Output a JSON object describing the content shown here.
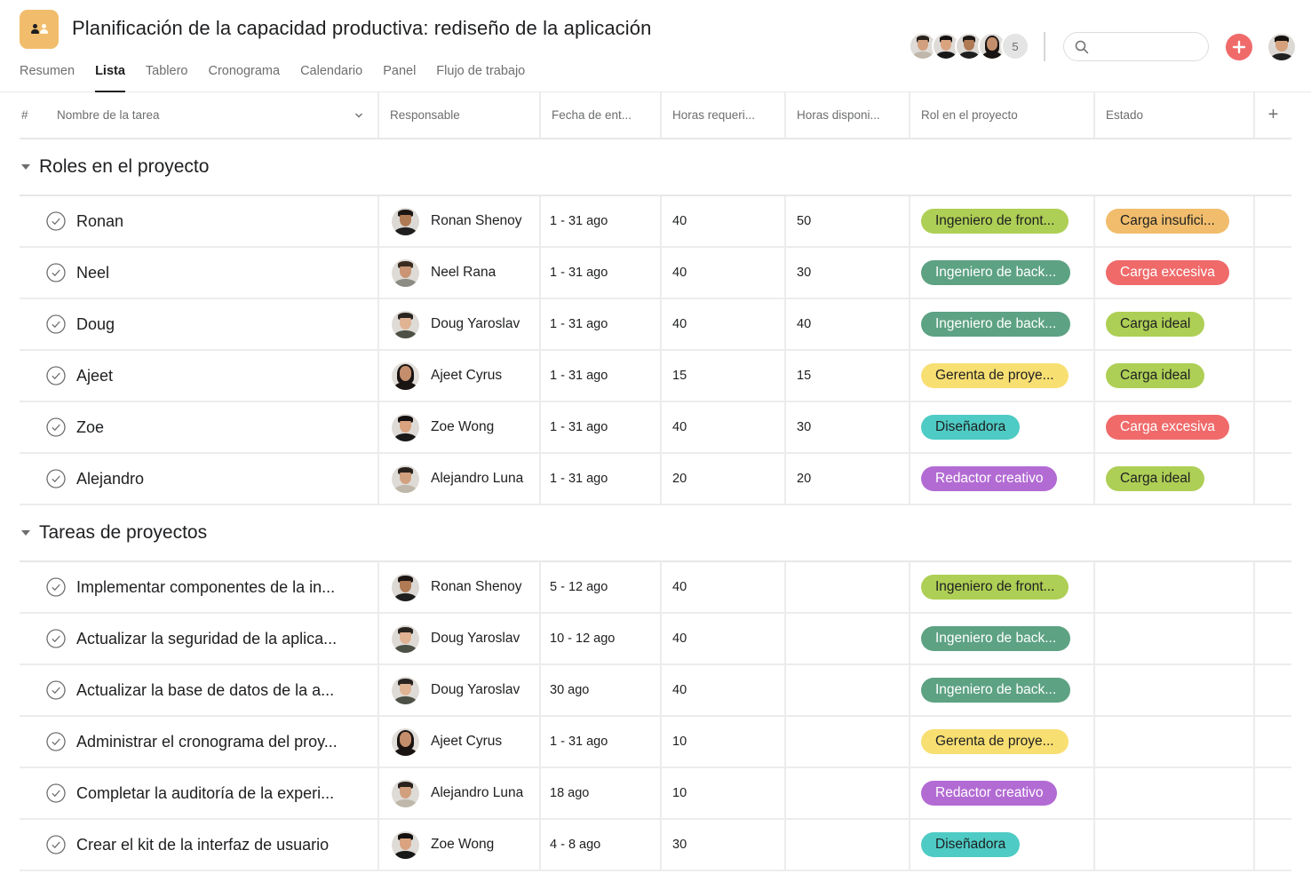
{
  "header": {
    "title": "Planificación de la capacidad productiva: rediseño de la aplicación",
    "project_icon": "people-icon",
    "project_icon_color": "#f1bd6c",
    "tabs": [
      {
        "label": "Resumen",
        "active": false
      },
      {
        "label": "Lista",
        "active": true
      },
      {
        "label": "Tablero",
        "active": false
      },
      {
        "label": "Cronograma",
        "active": false
      },
      {
        "label": "Calendario",
        "active": false
      },
      {
        "label": "Panel",
        "active": false
      },
      {
        "label": "Flujo de trabajo",
        "active": false
      }
    ],
    "members_count": "5",
    "search": {
      "placeholder": "",
      "value": ""
    },
    "add_button_color": "#f06a6a"
  },
  "columns": {
    "num": "#",
    "name": "Nombre de la tarea",
    "responsible": "Responsable",
    "due": "Fecha de ent...",
    "hours_required": "Horas requeri...",
    "hours_available": "Horas disponi...",
    "role": "Rol en el proyecto",
    "state": "Estado",
    "add": "+"
  },
  "colors": {
    "frontend": {
      "bg": "#aecf55",
      "fg": "#1e1f21"
    },
    "backend": {
      "bg": "#5da283",
      "fg": "#ffffff"
    },
    "pm": {
      "bg": "#f8df72",
      "fg": "#1e1f21"
    },
    "designer": {
      "bg": "#4ecbc4",
      "fg": "#1e1f21"
    },
    "writer": {
      "bg": "#b36bd4",
      "fg": "#ffffff"
    },
    "under": {
      "bg": "#f1bd6c",
      "fg": "#1e1f21"
    },
    "over": {
      "bg": "#f06a6a",
      "fg": "#ffffff"
    },
    "ideal": {
      "bg": "#aecf55",
      "fg": "#1e1f21"
    }
  },
  "sections": [
    {
      "title": "Roles en el proyecto",
      "rows": [
        {
          "name": "Ronan",
          "assignee": "Ronan Shenoy",
          "avatar": "ronan",
          "due": "1 - 31 ago",
          "req": "40",
          "avail": "50",
          "role": "Ingeniero de front...",
          "role_key": "frontend",
          "state": "Carga insufici...",
          "state_key": "under"
        },
        {
          "name": "Neel",
          "assignee": "Neel Rana",
          "avatar": "neel",
          "due": "1 - 31 ago",
          "req": "40",
          "avail": "30",
          "role": "Ingeniero de back...",
          "role_key": "backend",
          "state": "Carga excesiva",
          "state_key": "over"
        },
        {
          "name": "Doug",
          "assignee": "Doug Yaroslav",
          "avatar": "doug",
          "due": "1 - 31 ago",
          "req": "40",
          "avail": "40",
          "role": "Ingeniero de back...",
          "role_key": "backend",
          "state": "Carga ideal",
          "state_key": "ideal"
        },
        {
          "name": "Ajeet",
          "assignee": "Ajeet Cyrus",
          "avatar": "ajeet",
          "due": "1 - 31 ago",
          "req": "15",
          "avail": "15",
          "role": "Gerenta de proye...",
          "role_key": "pm",
          "state": "Carga ideal",
          "state_key": "ideal"
        },
        {
          "name": "Zoe",
          "assignee": "Zoe Wong",
          "avatar": "zoe",
          "due": "1 - 31 ago",
          "req": "40",
          "avail": "30",
          "role": "Diseñadora",
          "role_key": "designer",
          "state": "Carga excesiva",
          "state_key": "over"
        },
        {
          "name": "Alejandro",
          "assignee": "Alejandro Luna",
          "avatar": "alejandro",
          "due": "1 - 31 ago",
          "req": "20",
          "avail": "20",
          "role": "Redactor creativo",
          "role_key": "writer",
          "state": "Carga ideal",
          "state_key": "ideal"
        }
      ]
    },
    {
      "title": "Tareas de proyectos",
      "rows": [
        {
          "name": "Implementar componentes de la in...",
          "assignee": "Ronan Shenoy",
          "avatar": "ronan",
          "due": "5 - 12 ago",
          "req": "40",
          "avail": "",
          "role": "Ingeniero de front...",
          "role_key": "frontend",
          "state": "",
          "state_key": ""
        },
        {
          "name": "Actualizar la seguridad de la aplica...",
          "assignee": "Doug Yaroslav",
          "avatar": "doug",
          "due": "10 - 12 ago",
          "req": "40",
          "avail": "",
          "role": "Ingeniero de back...",
          "role_key": "backend",
          "state": "",
          "state_key": ""
        },
        {
          "name": "Actualizar la base de datos de la a...",
          "assignee": "Doug Yaroslav",
          "avatar": "doug",
          "due": "30 ago",
          "req": "40",
          "avail": "",
          "role": "Ingeniero de back...",
          "role_key": "backend",
          "state": "",
          "state_key": ""
        },
        {
          "name": "Administrar el cronograma del proy...",
          "assignee": "Ajeet Cyrus",
          "avatar": "ajeet",
          "due": "1 - 31 ago",
          "req": "10",
          "avail": "",
          "role": "Gerenta de proye...",
          "role_key": "pm",
          "state": "",
          "state_key": ""
        },
        {
          "name": "Completar la auditoría de la experi...",
          "assignee": "Alejandro Luna",
          "avatar": "alejandro",
          "due": "18 ago",
          "req": "10",
          "avail": "",
          "role": "Redactor creativo",
          "role_key": "writer",
          "state": "",
          "state_key": ""
        },
        {
          "name": "Crear el kit de la interfaz de usuario",
          "assignee": "Zoe Wong",
          "avatar": "zoe",
          "due": "4 - 8 ago",
          "req": "30",
          "avail": "",
          "role": "Diseñadora",
          "role_key": "designer",
          "state": "",
          "state_key": ""
        }
      ]
    }
  ]
}
